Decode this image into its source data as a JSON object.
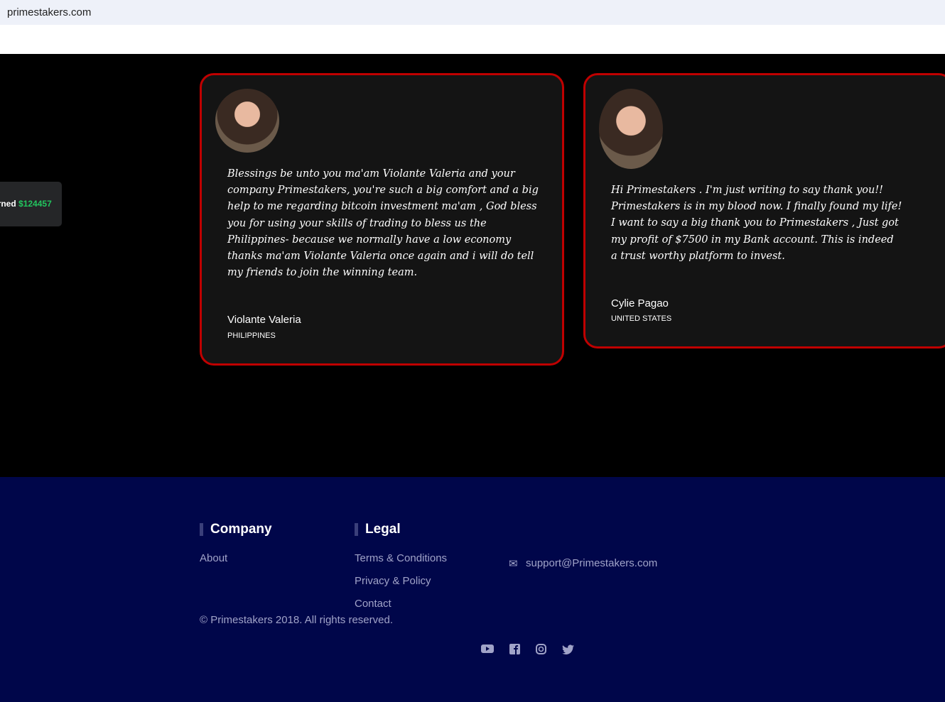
{
  "browser": {
    "url": "primestakers.com"
  },
  "earned_widget": {
    "label": "Earned",
    "amount": "$124457"
  },
  "testimonials": [
    {
      "quote": "Blessings be unto you ma'am Violante Valeria and your company Primestakers, you're such a big comfort and a big help to me regarding bitcoin investment ma'am , God bless you for using your skills of trading to bless us the Philippines- because we normally have a low economy thanks ma'am Violante Valeria once again and i will do tell my friends to join the winning team.",
      "name": "Violante Valeria",
      "country": "PHILIPPINES"
    },
    {
      "quote": "Hi Primestakers . I'm just writing to say thank you!! Primestakers is in my blood now. I finally found my life! I want to say a big thank you to Primestakers , Just got my profit of $7500 in my Bank account. This is indeed a trust worthy platform to invest.",
      "name": "Cylie Pagao",
      "country": "UNITED STATES"
    }
  ],
  "footer": {
    "company": {
      "title": "Company",
      "links": [
        "About"
      ]
    },
    "legal": {
      "title": "Legal",
      "links": [
        "Terms & Conditions",
        "Privacy & Policy",
        "Contact"
      ]
    },
    "email": "support@Primestakers.com",
    "copyright": "© Primestakers 2018. All rights reserved.",
    "social": [
      "youtube-icon",
      "facebook-icon",
      "instagram-icon",
      "twitter-icon"
    ]
  },
  "colors": {
    "accent": "#c00000",
    "footer_bg": "#00064a",
    "amount": "#22c55e"
  }
}
